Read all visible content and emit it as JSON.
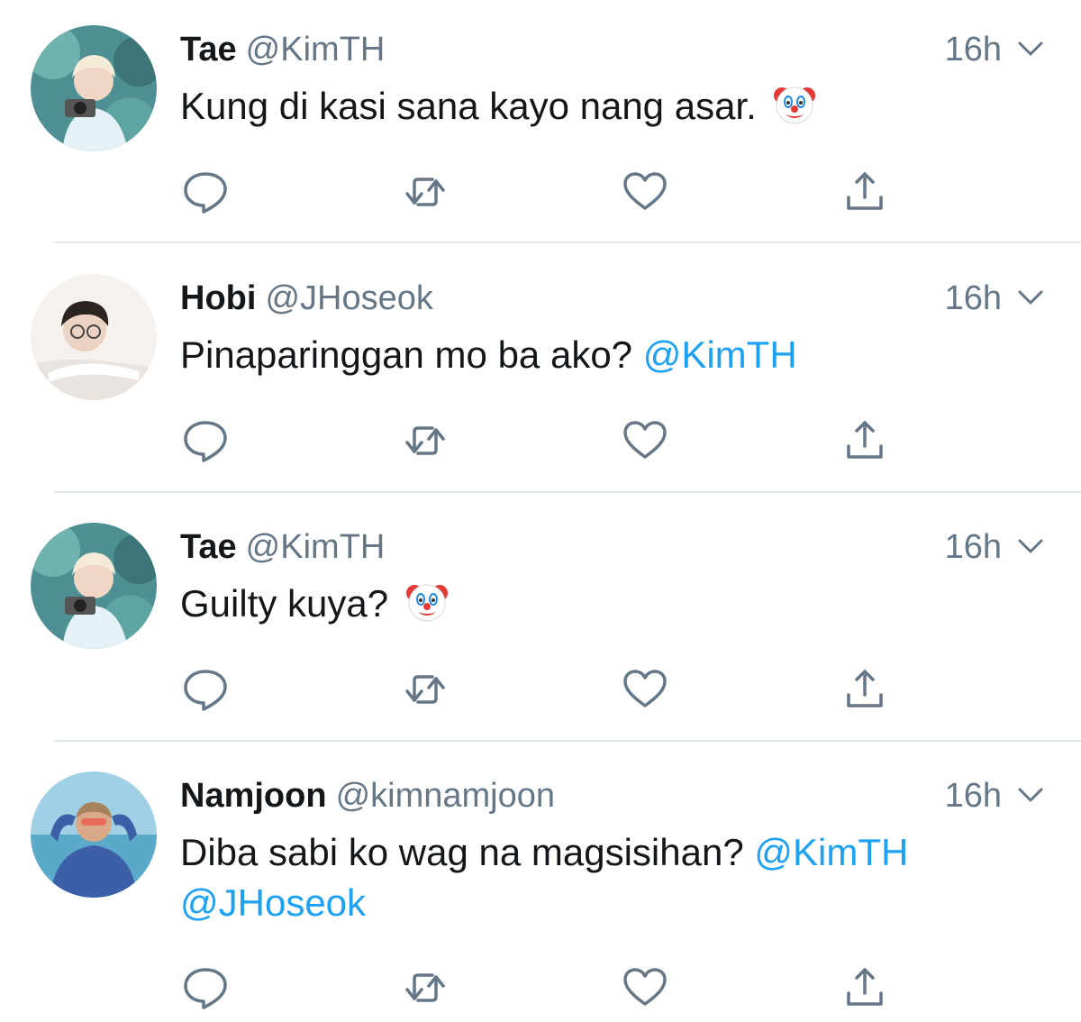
{
  "tweets": [
    {
      "name": "Tae",
      "handle": "@KimTH",
      "time": "16h",
      "text": "Kung di kasi sana kayo nang asar.",
      "mentions": [],
      "emoji": "clown-face"
    },
    {
      "name": "Hobi",
      "handle": "@JHoseok",
      "time": "16h",
      "text": "Pinaparinggan mo ba ako?",
      "mentions": [
        "@KimTH"
      ],
      "emoji": ""
    },
    {
      "name": "Tae",
      "handle": "@KimTH",
      "time": "16h",
      "text": "Guilty kuya?",
      "mentions": [],
      "emoji": "clown-face"
    },
    {
      "name": "Namjoon",
      "handle": "@kimnamjoon",
      "time": "16h",
      "text": "Diba sabi ko wag na magsisihan?",
      "mentions": [
        "@KimTH",
        "@JHoseok"
      ],
      "emoji": ""
    }
  ],
  "icons": {
    "reply": "reply-icon",
    "retweet": "retweet-icon",
    "like": "heart-icon",
    "share": "share-icon",
    "menu": "chevron-down-icon"
  },
  "colors": {
    "mention": "#1da1f2",
    "secondary_text": "#657786",
    "icon": "#657786",
    "divider": "#e1e8ed"
  }
}
